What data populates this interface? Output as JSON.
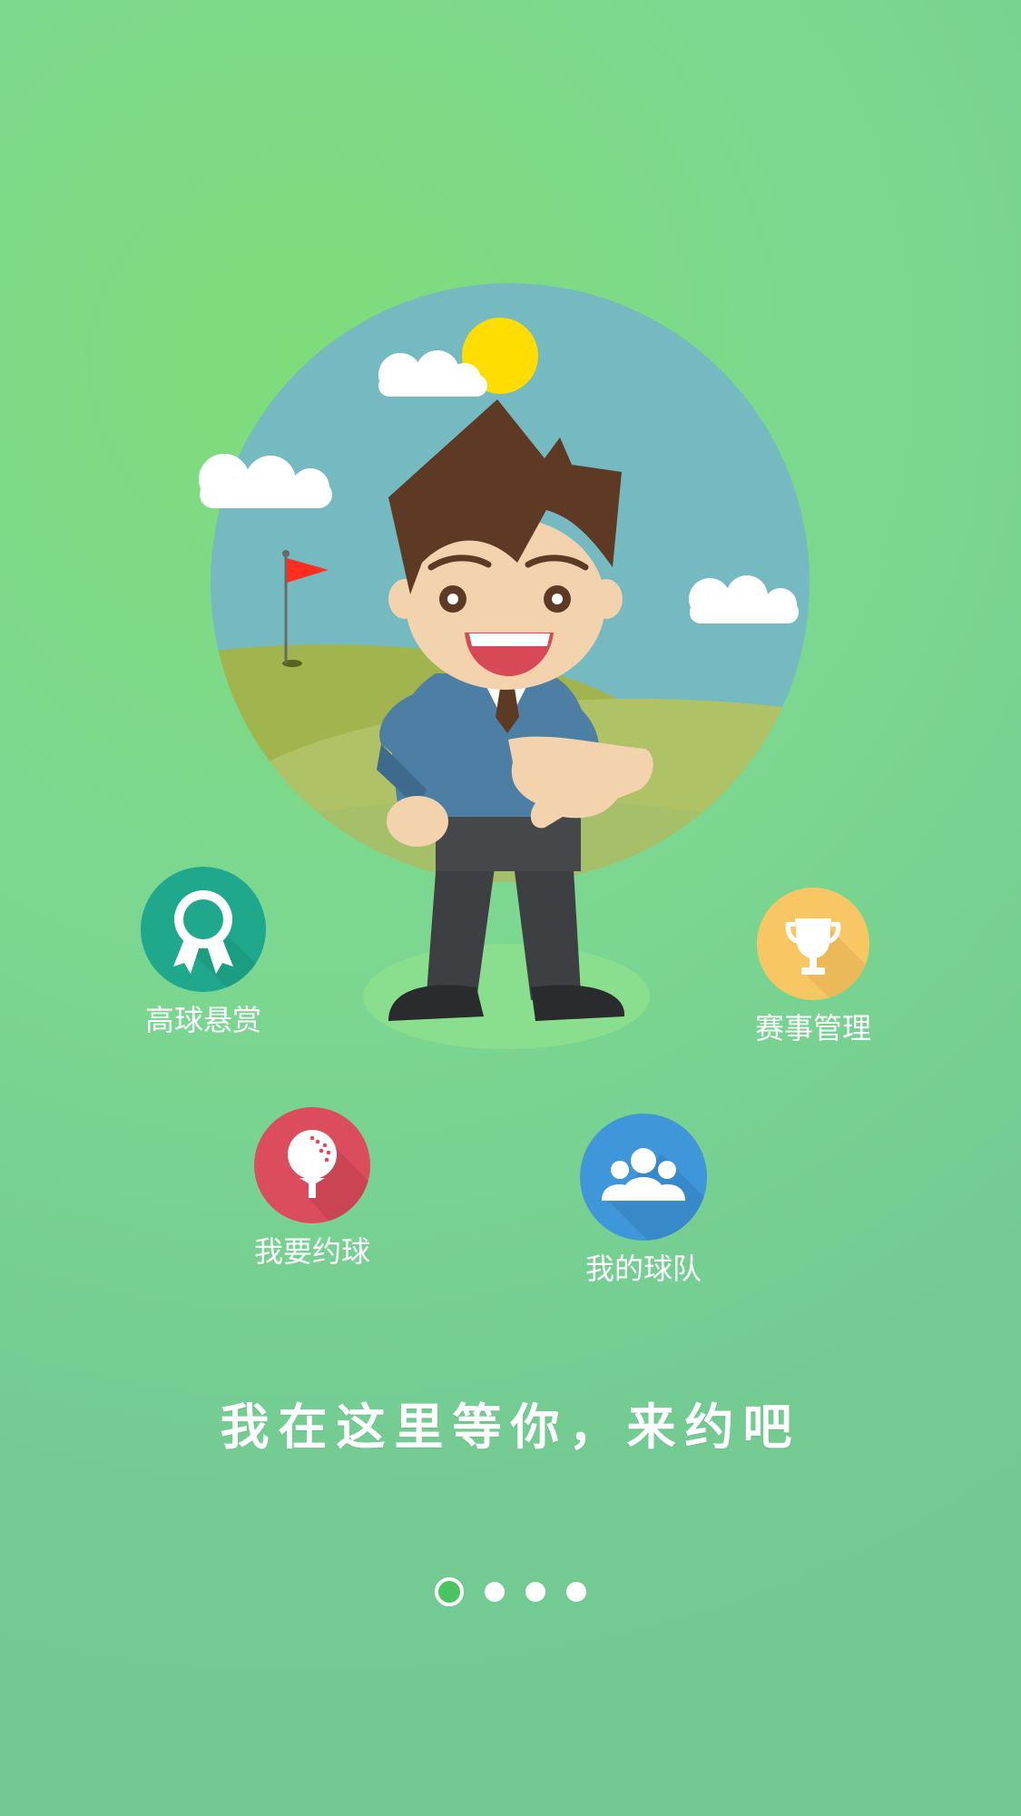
{
  "features": {
    "reward": {
      "label": "高球悬赏",
      "icon": "ribbon-badge-icon",
      "color": "#20a88d"
    },
    "match": {
      "label": "赛事管理",
      "icon": "trophy-icon",
      "color": "#f8c763"
    },
    "book": {
      "label": "我要约球",
      "icon": "golf-ball-icon",
      "color": "#db4d5d"
    },
    "team": {
      "label": "我的球队",
      "icon": "team-icon",
      "color": "#3f96d9"
    }
  },
  "slogan": "我在这里等你，来约吧",
  "pager": {
    "total": 4,
    "active": 1
  },
  "colors": {
    "background": "#74cc92",
    "sky": "#74bac0",
    "grass": "#a8b956",
    "sun": "#ffdd00",
    "flag": "#ff2e1e"
  }
}
